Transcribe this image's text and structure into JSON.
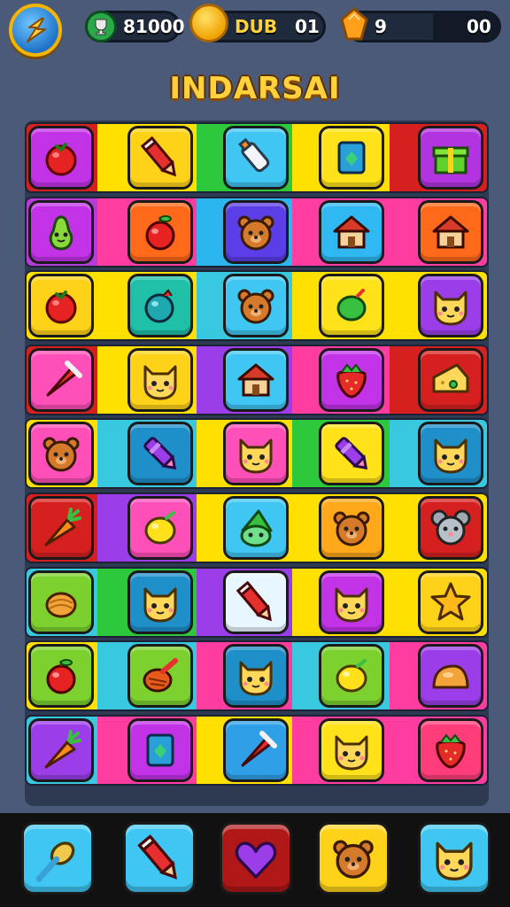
{
  "hud": {
    "player_score": "81000",
    "coin_label": "DUB",
    "coin_value": "01",
    "gem_value": "9",
    "gem_total": "00"
  },
  "title": "INDARSAI",
  "colors": {
    "background": "#4b5a78",
    "title": "#ffd23c",
    "hud_pill": "#1f2a3d"
  },
  "board": {
    "rows": [
      {
        "stripes": [
          "#d62020",
          "#ffe000",
          "#2ec83c",
          "#ffe000",
          "#d62020"
        ],
        "tiles": [
          {
            "bg": "#c233e8",
            "icon": "tomato-icon"
          },
          {
            "bg": "#ffd21a",
            "icon": "pencil-icon"
          },
          {
            "bg": "#3fc6f2",
            "icon": "bottle-icon"
          },
          {
            "bg": "#ffe21a",
            "icon": "box-icon"
          },
          {
            "bg": "#b233e0",
            "icon": "gift-icon"
          }
        ]
      },
      {
        "stripes": [
          "#b63bd8",
          "#ff3da0",
          "#2bb6f0",
          "#ff3da0",
          "#ff3da0"
        ],
        "tiles": [
          {
            "bg": "#c233e8",
            "icon": "pear-icon"
          },
          {
            "bg": "#ff6a1a",
            "icon": "apple-icon"
          },
          {
            "bg": "#5b3ee8",
            "icon": "bear-icon"
          },
          {
            "bg": "#2fb8f2",
            "icon": "house-icon"
          },
          {
            "bg": "#ff6a1a",
            "icon": "house-icon"
          }
        ]
      },
      {
        "stripes": [
          "#ffe000",
          "#ffe000",
          "#38c8e0",
          "#ffe000",
          "#ffe000"
        ],
        "tiles": [
          {
            "bg": "#ffd21a",
            "icon": "tomato-icon"
          },
          {
            "bg": "#1fbfa8",
            "icon": "berry-icon"
          },
          {
            "bg": "#3fc6f2",
            "icon": "bear-icon"
          },
          {
            "bg": "#ffe21a",
            "icon": "lime-icon"
          },
          {
            "bg": "#9b3de8",
            "icon": "cat-icon"
          }
        ]
      },
      {
        "stripes": [
          "#d62020",
          "#ffe000",
          "#9b3de8",
          "#ff3da0",
          "#d62020"
        ],
        "tiles": [
          {
            "bg": "#ff4fb8",
            "icon": "cone-icon"
          },
          {
            "bg": "#ffd21a",
            "icon": "cat-icon"
          },
          {
            "bg": "#3fc6f2",
            "icon": "house-icon"
          },
          {
            "bg": "#c233e8",
            "icon": "strawberry-icon"
          },
          {
            "bg": "#d62020",
            "icon": "cheese-icon"
          }
        ]
      },
      {
        "stripes": [
          "#ffe000",
          "#38c8e0",
          "#ffe000",
          "#2ec83c",
          "#38c8e0"
        ],
        "tiles": [
          {
            "bg": "#ff4fb8",
            "icon": "bear-icon"
          },
          {
            "bg": "#1e8fc8",
            "icon": "crayon-icon"
          },
          {
            "bg": "#ff4fb8",
            "icon": "cat-icon"
          },
          {
            "bg": "#ffe21a",
            "icon": "crayon-icon"
          },
          {
            "bg": "#1e8fc8",
            "icon": "cat-icon"
          }
        ]
      },
      {
        "stripes": [
          "#d62020",
          "#9b3de8",
          "#ffe000",
          "#ffe000",
          "#ffe000"
        ],
        "tiles": [
          {
            "bg": "#d62020",
            "icon": "carrot-icon"
          },
          {
            "bg": "#ff4fb8",
            "icon": "lemon-icon"
          },
          {
            "bg": "#3fc6f2",
            "icon": "gnome-icon"
          },
          {
            "bg": "#ffa81a",
            "icon": "bear-icon"
          },
          {
            "bg": "#d62020",
            "icon": "mouse-icon"
          }
        ]
      },
      {
        "stripes": [
          "#38c8e0",
          "#2ec83c",
          "#9b3de8",
          "#ffe000",
          "#ffe000"
        ],
        "tiles": [
          {
            "bg": "#7dd12e",
            "icon": "nut-icon"
          },
          {
            "bg": "#1e8fc8",
            "icon": "cat-icon"
          },
          {
            "bg": "#e8f6ff",
            "icon": "pencil-icon"
          },
          {
            "bg": "#c233e8",
            "icon": "cat-icon"
          },
          {
            "bg": "#ffd21a",
            "icon": "star-icon"
          }
        ]
      },
      {
        "stripes": [
          "#ffe000",
          "#38c8e0",
          "#ff3da0",
          "#38c8e0",
          "#ff3da0"
        ],
        "tiles": [
          {
            "bg": "#7dd12e",
            "icon": "apple-icon"
          },
          {
            "bg": "#7dd12e",
            "icon": "top-icon"
          },
          {
            "bg": "#1e8fc8",
            "icon": "cat-icon"
          },
          {
            "bg": "#7dd12e",
            "icon": "lemon-icon"
          },
          {
            "bg": "#9b3de8",
            "icon": "bun-icon"
          }
        ]
      },
      {
        "stripes": [
          "#38c8e0",
          "#ff3da0",
          "#ffe000",
          "#ff3da0",
          "#ff3da0"
        ],
        "tiles": [
          {
            "bg": "#9b3de8",
            "icon": "carrot-icon"
          },
          {
            "bg": "#c233e8",
            "icon": "box-icon"
          },
          {
            "bg": "#2fa0e8",
            "icon": "cone-icon"
          },
          {
            "bg": "#ffe21a",
            "icon": "cat-icon"
          },
          {
            "bg": "#ff3d7a",
            "icon": "strawberry-icon"
          }
        ]
      }
    ]
  },
  "dock": [
    {
      "bg": "#3fc6f2",
      "icon": "spoon-icon"
    },
    {
      "bg": "#3fc6f2",
      "icon": "pencil-icon"
    },
    {
      "bg": "#b01818",
      "icon": "heart-icon"
    },
    {
      "bg": "#ffd21a",
      "icon": "bear-icon"
    },
    {
      "bg": "#3fc6f2",
      "icon": "cat-icon"
    }
  ]
}
